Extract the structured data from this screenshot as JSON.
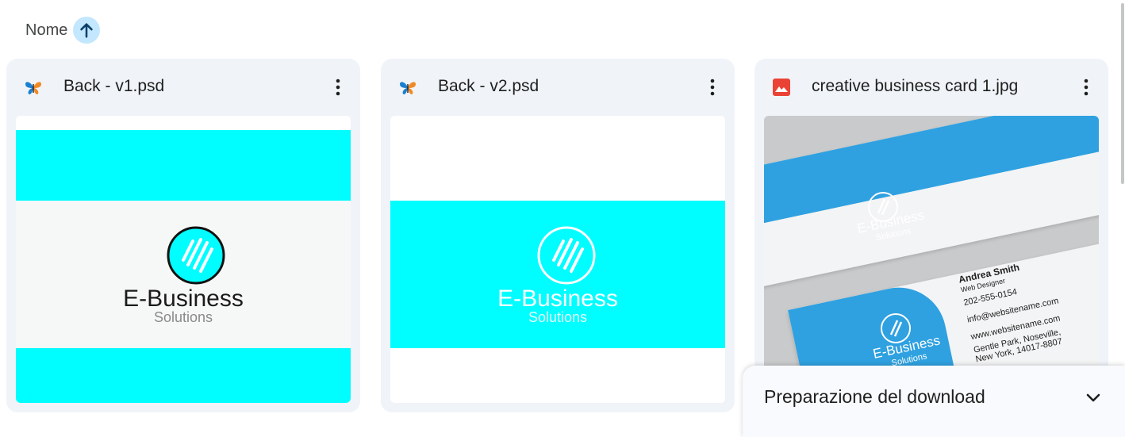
{
  "sort": {
    "label": "Nome",
    "icon": "arrow-up-icon",
    "accent": "#c2e7ff"
  },
  "files": [
    {
      "name": "Back - v1.psd",
      "icon": "photoshop-butterfly-icon",
      "thumbnail": {
        "brand": "E-Business",
        "tagline": "Solutions",
        "accent": "#00fdff"
      }
    },
    {
      "name": "Back - v2.psd",
      "icon": "photoshop-butterfly-icon",
      "thumbnail": {
        "brand": "E-Business",
        "tagline": "Solutions",
        "accent": "#00fdff"
      }
    },
    {
      "name": "creative business card 1.jpg",
      "icon": "image-file-icon",
      "thumbnail": {
        "brand": "E-Business",
        "tagline": "Solutions",
        "person": "Andrea Smith",
        "role": "Web Designer",
        "phone": "202-555-0154",
        "email": "info@websitename.com",
        "website": "www.websitename.com",
        "address": "Gentle Park, Noseville, New York, 14017-8807",
        "accent": "#2fa1e0"
      }
    }
  ],
  "download": {
    "title": "Preparazione del download",
    "toggle_icon": "chevron-down-icon"
  }
}
